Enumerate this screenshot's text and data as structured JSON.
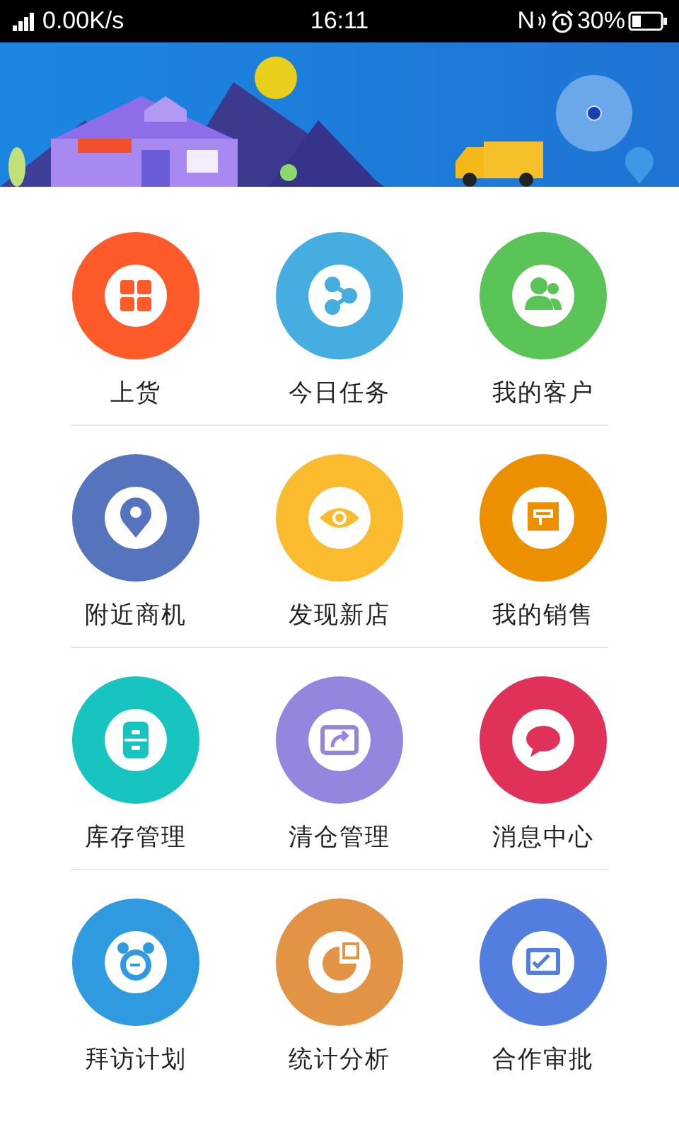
{
  "status_bar": {
    "network_speed": "0.00K/s",
    "time": "16:11",
    "nfc": "N",
    "battery": "30%"
  },
  "menu": [
    {
      "label": "上货",
      "color": "#ff5a2a",
      "kind": "grid"
    },
    {
      "label": "今日任务",
      "color": "#45addf",
      "kind": "share"
    },
    {
      "label": "我的客户",
      "color": "#5ac456",
      "kind": "people"
    },
    {
      "label": "附近商机",
      "color": "#5673be",
      "kind": "pin"
    },
    {
      "label": "发现新店",
      "color": "#fbbb2e",
      "kind": "eye"
    },
    {
      "label": "我的销售",
      "color": "#ec9000",
      "kind": "note"
    },
    {
      "label": "库存管理",
      "color": "#17c4c0",
      "kind": "drawers"
    },
    {
      "label": "清仓管理",
      "color": "#9485de",
      "kind": "forward"
    },
    {
      "label": "消息中心",
      "color": "#e03259",
      "kind": "chat"
    },
    {
      "label": "拜访计划",
      "color": "#2f9ae0",
      "kind": "clock"
    },
    {
      "label": "统计分析",
      "color": "#e29444",
      "kind": "pie"
    },
    {
      "label": "合作审批",
      "color": "#537ee0",
      "kind": "check"
    }
  ]
}
